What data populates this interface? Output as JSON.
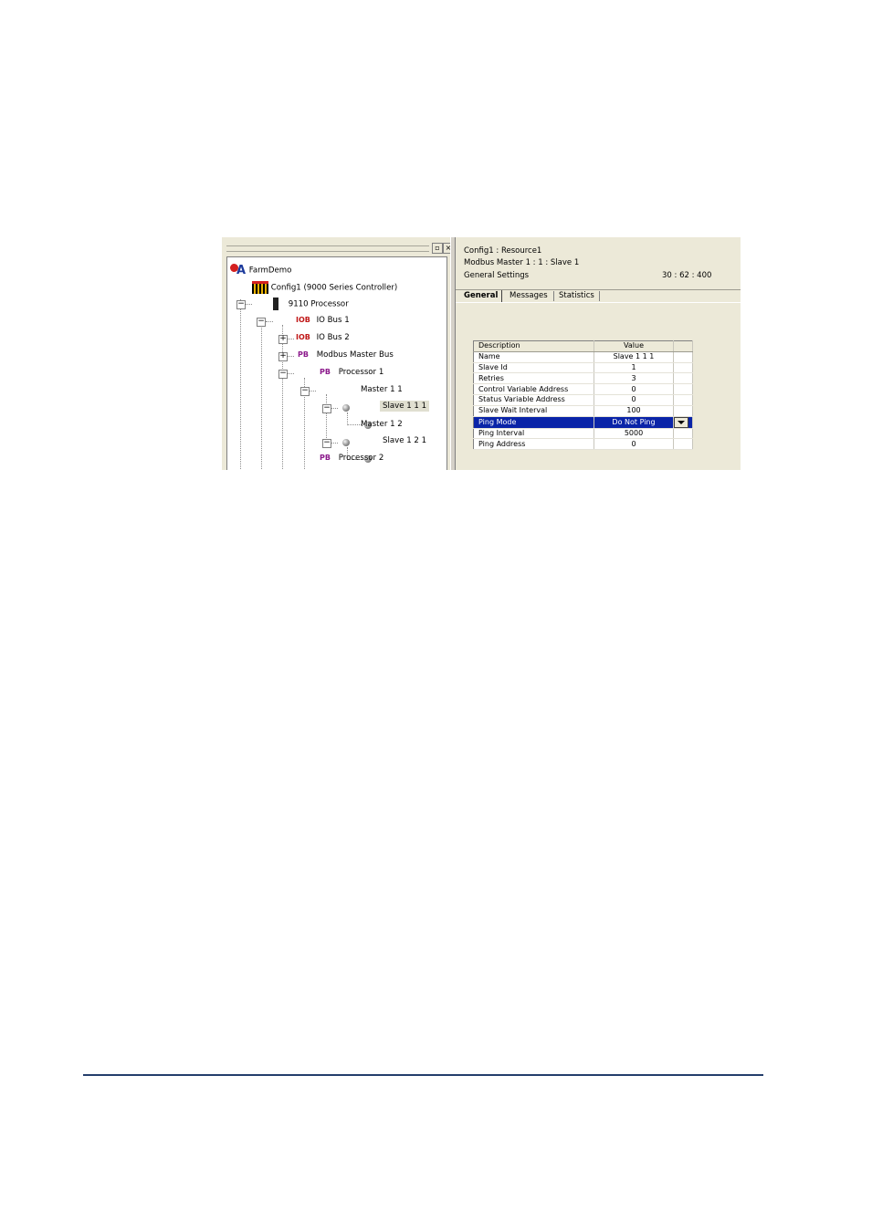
{
  "tree": {
    "root": "FarmDemo",
    "config": "Config1 (9000 Series Controller)",
    "processor": "9110 Processor",
    "io_bus_1": {
      "badge": "IOB",
      "label": "IO Bus 1"
    },
    "io_bus_2": {
      "badge": "IOB",
      "label": "IO Bus 2"
    },
    "modbus_bus": {
      "badge": "PB",
      "label": "Modbus Master Bus"
    },
    "processor_1": {
      "badge": "PB",
      "label": "Processor 1"
    },
    "master_1_1": "Master 1 1",
    "slave_1_1_1": "Slave 1 1 1",
    "master_1_2": "Master 1 2",
    "slave_1_2_1": "Slave 1 2 1",
    "processor_2": {
      "badge": "PB",
      "label": "Processor 2"
    }
  },
  "header": {
    "line1": "Config1 : Resource1",
    "line2": "Modbus Master 1 : 1 : Slave 1",
    "line3": "General Settings",
    "coords": "30 : 62 : 400"
  },
  "tabs": [
    "General",
    "Messages",
    "Statistics"
  ],
  "grid": {
    "col_description": "Description",
    "col_value": "Value",
    "rows": [
      {
        "desc": "Name",
        "value": "Slave 1 1 1"
      },
      {
        "desc": "Slave Id",
        "value": "1"
      },
      {
        "desc": "Retries",
        "value": "3"
      },
      {
        "desc": "Control Variable Address",
        "value": "0"
      },
      {
        "desc": "Status Variable Address",
        "value": "0"
      },
      {
        "desc": "Slave Wait Interval",
        "value": "100"
      },
      {
        "desc": "Ping Mode",
        "value": "Do Not Ping"
      },
      {
        "desc": "Ping Interval",
        "value": "5000"
      },
      {
        "desc": "Ping Address",
        "value": "0"
      }
    ]
  },
  "colors": {
    "selection": "#0a24a8",
    "panel": "#ece9d8",
    "divider": "#243e6b"
  }
}
